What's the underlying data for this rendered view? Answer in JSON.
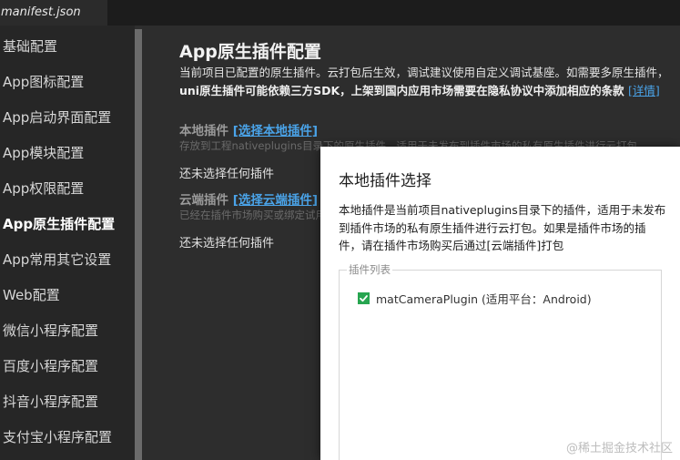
{
  "tab": {
    "label": "manifest.json"
  },
  "sidebar": {
    "items": [
      {
        "label": "基础配置"
      },
      {
        "label": "App图标配置"
      },
      {
        "label": "App启动界面配置"
      },
      {
        "label": "App模块配置"
      },
      {
        "label": "App权限配置"
      },
      {
        "label": "App原生插件配置",
        "active": true
      },
      {
        "label": "App常用其它设置"
      },
      {
        "label": "Web配置"
      },
      {
        "label": "微信小程序配置"
      },
      {
        "label": "百度小程序配置"
      },
      {
        "label": "抖音小程序配置"
      },
      {
        "label": "支付宝小程序配置"
      }
    ]
  },
  "main": {
    "title": "App原生插件配置",
    "desc_line1": "当前项目已配置的原生插件。云打包后生效，调试建议使用自定义调试基座。如需要多原生插件，",
    "desc_line2": "uni原生插件可能依赖三方SDK，上架到国内应用市场需要在隐私协议中添加相应的条款",
    "detail_link": "[详情]",
    "local": {
      "title": "本地插件",
      "link": "[选择本地插件]",
      "hint": "存放到工程nativeplugins目录下的原生插件，适用于未发布到插件市场的私有原生插件进行云打包",
      "empty": "还未选择任何插件"
    },
    "cloud": {
      "title": "云端插件",
      "link": "[选择云端插件]",
      "hint": "已经在插件市场购买或绑定试用的插件",
      "empty": "还未选择任何插件"
    }
  },
  "dialog": {
    "title": "本地插件选择",
    "description": "本地插件是当前项目nativeplugins目录下的插件，适用于未发布到插件市场的私有原生插件进行云打包。如果是插件市场的插件，请在插件市场购买后通过[云端插件]打包",
    "legend": "插件列表",
    "plugins": [
      {
        "label": "matCameraPlugin (适用平台：Android)",
        "checked": true
      }
    ]
  },
  "watermark": "@稀土掘金技术社区",
  "colors": {
    "accent_link": "#4aa3e8",
    "checkbox": "#27a550",
    "background": "#2d2d2d"
  }
}
